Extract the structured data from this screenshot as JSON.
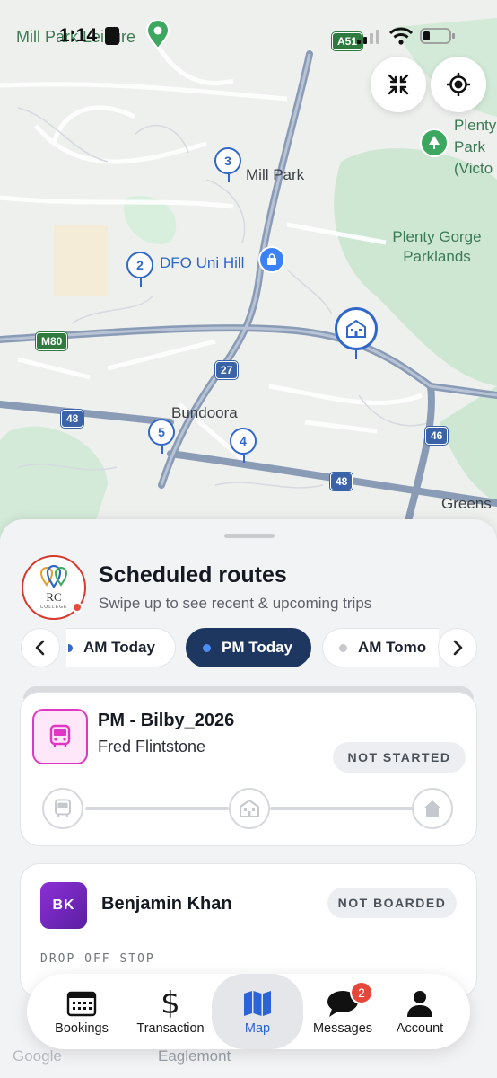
{
  "status_bar": {
    "time": "1:14",
    "map_overlay_text": "Mill Park Leisure"
  },
  "map": {
    "labels": {
      "mill_park": "Mill Park",
      "dfo": "DFO Uni Hill",
      "plenty_gorge": "Plenty Gorge Parklands",
      "plenty_park": "Plenty Park (Victo",
      "bundoora": "Bundoora",
      "greens": "Greens",
      "bottom_partial": "Bundoora"
    },
    "shields": {
      "a51": "A51",
      "m80": "M80",
      "r27": "27",
      "r48a": "48",
      "r48b": "48",
      "r46": "46"
    },
    "stops": [
      "2",
      "3",
      "4",
      "5"
    ]
  },
  "sheet": {
    "title": "Scheduled routes",
    "subtitle": "Swipe up to see recent & upcoming trips",
    "logo_text": "RC",
    "logo_subtext": "COLLEGE",
    "chips": [
      {
        "label": "AM Today",
        "dot": "#3167c9"
      },
      {
        "label": "PM Today",
        "dot": "#4b8ef5"
      },
      {
        "label": "AM Tomo",
        "dot": "#c7c9cc"
      }
    ]
  },
  "route_card": {
    "route_name": "PM - Bilby_2026",
    "driver": "Fred Flintstone",
    "status": "NOT STARTED"
  },
  "student_card": {
    "initials": "BK",
    "name": "Benjamin Khan",
    "status": "NOT BOARDED",
    "section_label": "DROP-OFF STOP"
  },
  "tabbar": {
    "tabs": [
      {
        "label": "Bookings",
        "icon": "calendar-icon"
      },
      {
        "label": "Transaction",
        "icon": "dollar-icon"
      },
      {
        "label": "Map",
        "icon": "map-icon"
      },
      {
        "label": "Messages",
        "icon": "chat-icon",
        "badge": "2"
      },
      {
        "label": "Account",
        "icon": "person-icon"
      }
    ]
  },
  "below_tabbar": {
    "left": "Google",
    "center": "Eaglemont"
  },
  "colors": {
    "accent": "#1d3760",
    "map_blue": "#3167c9",
    "route_pink": "#e135c4",
    "student_purple": "#7a28c4"
  }
}
